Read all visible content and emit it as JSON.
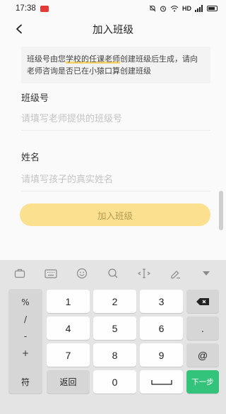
{
  "status_bar": {
    "time": "17:38",
    "network": "HD",
    "notification_badge": "■"
  },
  "header": {
    "title": "加入班级",
    "back_icon": "chevron-left-icon"
  },
  "notice": {
    "part1": "班级号由您",
    "highlight1": "学校的任课老师",
    "part2": "创建班级后生成，请向老师咨询是否已在小猿口算创建班级"
  },
  "form": {
    "class_label": "班级号",
    "class_placeholder": "请填写老师提供的班级号",
    "name_label": "姓名",
    "name_placeholder": "请填写孩子的真实姓名"
  },
  "join_button": {
    "label": "加入班级",
    "color": "#fbe090"
  },
  "keyboard": {
    "toolbar_icons": [
      "briefcase-icon",
      "keyboard-icon",
      "emoji-icon",
      "search-icon",
      "cursor-icon",
      "edit-icon",
      "collapse-icon"
    ],
    "symbols": [
      "%",
      "/",
      "-",
      "+"
    ],
    "digits_row1": [
      "1",
      "2",
      "3"
    ],
    "digits_row2": [
      "4",
      "5",
      "6"
    ],
    "digits_row3": [
      "7",
      "8",
      "9"
    ],
    "zero": "0",
    "dot": ".",
    "at": "@",
    "sym_key": "符",
    "return_key": "返回",
    "space_key": "",
    "next_key": "下一步",
    "delete_icon": "backspace-icon",
    "accent": "#33c37a"
  }
}
